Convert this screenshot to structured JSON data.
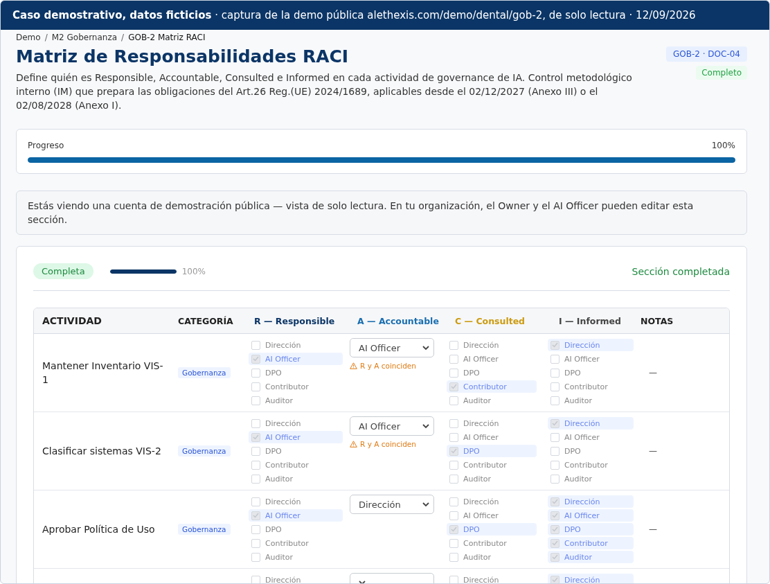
{
  "banner": "**Caso demostrativo, datos ficticios** · captura de la demo pública alethexis.com/demo/dental/gob-2, de solo lectura · 12/09/2026",
  "breadcrumb": {
    "separator": "/",
    "items": [
      "Demo",
      "M2 Gobernanza",
      "GOB-2 Matriz RACI"
    ]
  },
  "title": "Matriz de Responsabilidades RACI",
  "description": "Define quién es Responsible, Accountable, Consulted e Informed en cada actividad de governance de IA. Control metodológico interno (IM) que prepara las obligaciones del Art.26 Reg.(UE) 2024/1689, aplicables desde el 02/12/2027 (Anexo III) o el 02/08/2028 (Anexo I).",
  "code_badge": "GOB-2 · DOC-04",
  "status_badge": "Completo",
  "progress": {
    "label": "Progreso",
    "reading": "100%",
    "level": 1
  },
  "notice": "Estás viendo una cuenta de demostración pública — vista de solo lectura. En tu organización, el Owner y el AI Officer pueden editar esta sección.",
  "section": {
    "status": "Completa",
    "level": 1,
    "reading": "100%",
    "done_text": "Sección completada"
  },
  "table": {
    "columns": [
      {
        "label": "ACTIVIDAD",
        "kind": "plain"
      },
      {
        "label": "CATEGORÍA",
        "kind": "plain"
      },
      {
        "label": "R — Responsible",
        "kind": "r"
      },
      {
        "label": "A — Accountable",
        "kind": "a"
      },
      {
        "label": "C — Consulted",
        "kind": "c"
      },
      {
        "label": "I — Informed",
        "kind": "i"
      },
      {
        "label": "NOTAS",
        "kind": "plain"
      }
    ],
    "rows": [
      {
        "activity": "Mantener Inventario VIS-1",
        "category": "Gobernanza",
        "responsible": [
          {
            "label": "Dirección",
            "checked": false
          },
          {
            "label": "AI Officer",
            "checked": true
          },
          {
            "label": "DPO",
            "checked": false
          },
          {
            "label": "Contributor",
            "checked": false
          },
          {
            "label": "Auditor",
            "checked": false
          }
        ],
        "accountable": {
          "value": "AI Officer",
          "warning": "R y A coinciden"
        },
        "consulted": [
          {
            "label": "Dirección",
            "checked": false
          },
          {
            "label": "AI Officer",
            "checked": false
          },
          {
            "label": "DPO",
            "checked": false
          },
          {
            "label": "Contributor",
            "checked": true
          },
          {
            "label": "Auditor",
            "checked": false
          }
        ],
        "informed": [
          {
            "label": "Dirección",
            "checked": true
          },
          {
            "label": "AI Officer",
            "checked": false
          },
          {
            "label": "DPO",
            "checked": false
          },
          {
            "label": "Contributor",
            "checked": false
          },
          {
            "label": "Auditor",
            "checked": false
          }
        ],
        "notes": "—"
      },
      {
        "activity": "Clasificar sistemas VIS-2",
        "category": "Gobernanza",
        "responsible": [
          {
            "label": "Dirección",
            "checked": false
          },
          {
            "label": "AI Officer",
            "checked": true
          },
          {
            "label": "DPO",
            "checked": false
          },
          {
            "label": "Contributor",
            "checked": false
          },
          {
            "label": "Auditor",
            "checked": false
          }
        ],
        "accountable": {
          "value": "AI Officer",
          "warning": "R y A coinciden"
        },
        "consulted": [
          {
            "label": "Dirección",
            "checked": false
          },
          {
            "label": "AI Officer",
            "checked": false
          },
          {
            "label": "DPO",
            "checked": true
          },
          {
            "label": "Contributor",
            "checked": false
          },
          {
            "label": "Auditor",
            "checked": false
          }
        ],
        "informed": [
          {
            "label": "Dirección",
            "checked": true
          },
          {
            "label": "AI Officer",
            "checked": false
          },
          {
            "label": "DPO",
            "checked": false
          },
          {
            "label": "Contributor",
            "checked": false
          },
          {
            "label": "Auditor",
            "checked": false
          }
        ],
        "notes": "—"
      },
      {
        "activity": "Aprobar Política de Uso",
        "category": "Gobernanza",
        "responsible": [
          {
            "label": "Dirección",
            "checked": false
          },
          {
            "label": "AI Officer",
            "checked": true
          },
          {
            "label": "DPO",
            "checked": false
          },
          {
            "label": "Contributor",
            "checked": false
          },
          {
            "label": "Auditor",
            "checked": false
          }
        ],
        "accountable": {
          "value": "Dirección"
        },
        "consulted": [
          {
            "label": "Dirección",
            "checked": false
          },
          {
            "label": "AI Officer",
            "checked": false
          },
          {
            "label": "DPO",
            "checked": true
          },
          {
            "label": "Contributor",
            "checked": false
          },
          {
            "label": "Auditor",
            "checked": false
          }
        ],
        "informed": [
          {
            "label": "Dirección",
            "checked": true
          },
          {
            "label": "AI Officer",
            "checked": true
          },
          {
            "label": "DPO",
            "checked": true
          },
          {
            "label": "Contributor",
            "checked": true
          },
          {
            "label": "Auditor",
            "checked": true
          }
        ],
        "notes": "—"
      },
      {
        "responsible": [
          {
            "label": "Dirección",
            "checked": false
          }
        ],
        "accountable": {},
        "consulted": [
          {
            "label": "Dirección",
            "checked": false
          }
        ],
        "informed": [
          {
            "label": "Dirección",
            "checked": true
          }
        ]
      }
    ]
  }
}
